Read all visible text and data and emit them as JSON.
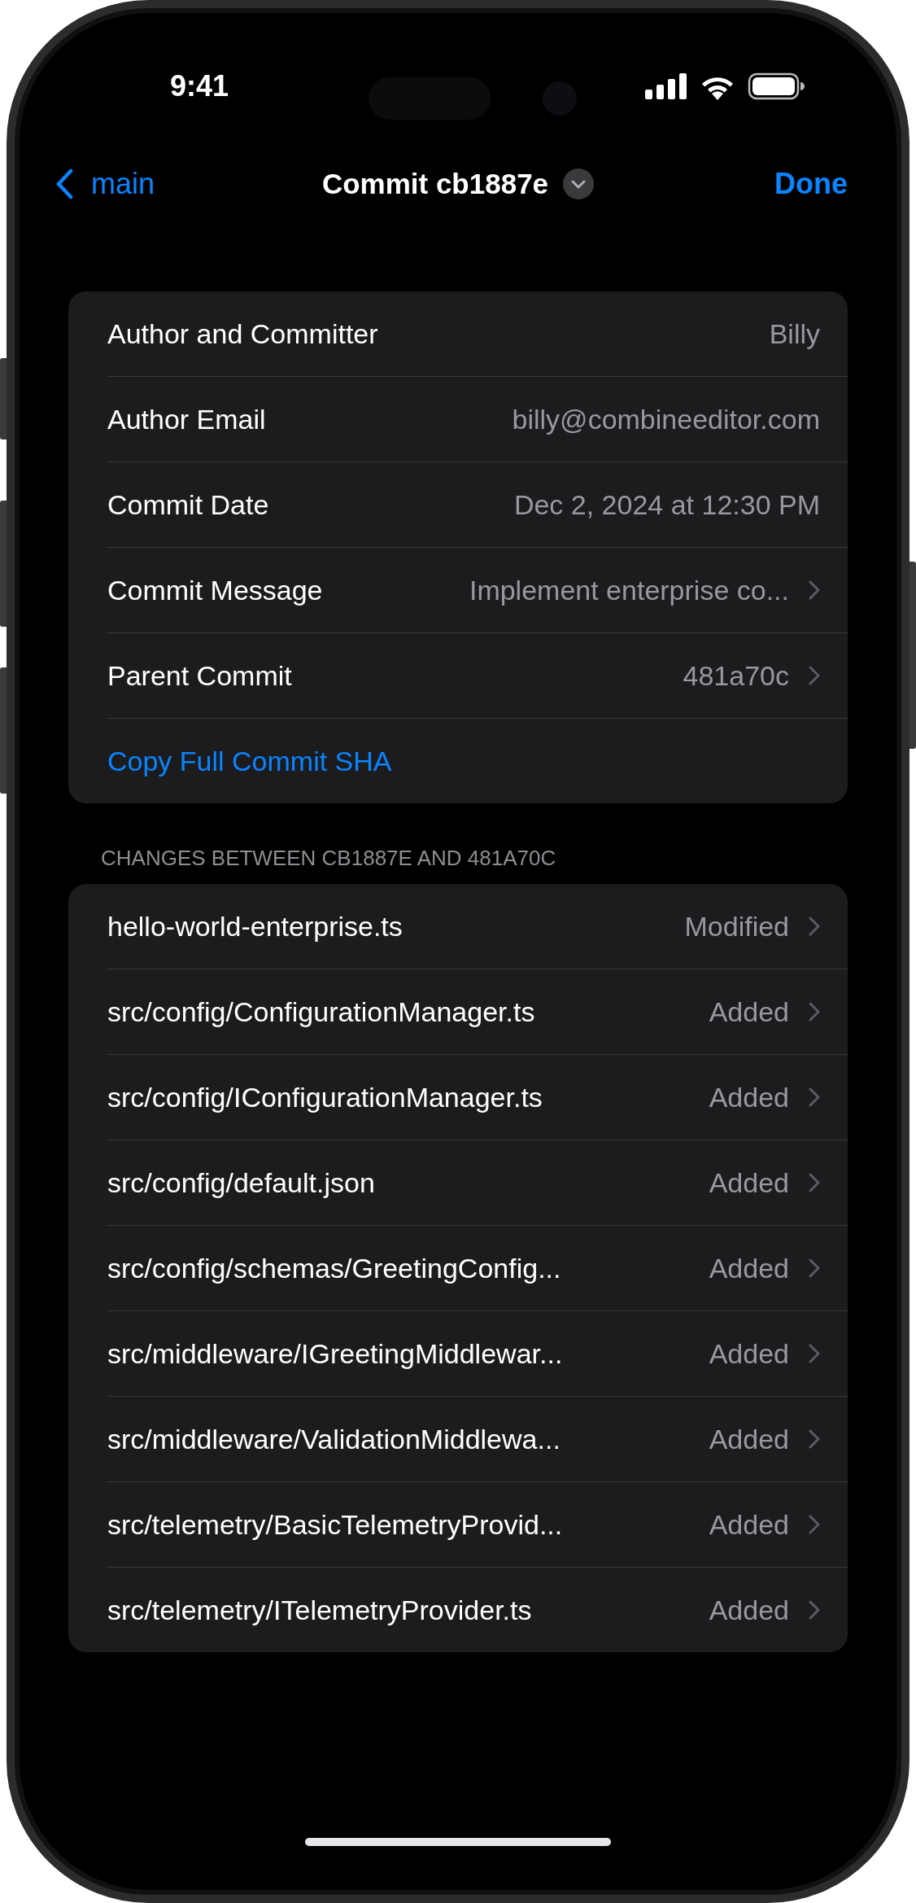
{
  "status_bar": {
    "time": "9:41"
  },
  "nav": {
    "back": "main",
    "title": "Commit cb1887e",
    "done": "Done"
  },
  "details": [
    {
      "kind": "value",
      "label": "Author and Committer",
      "value": "Billy",
      "disclosure": false
    },
    {
      "kind": "value",
      "label": "Author Email",
      "value": "billy@combineeditor.com",
      "disclosure": false
    },
    {
      "kind": "value",
      "label": "Commit Date",
      "value": "Dec 2, 2024 at 12:30 PM",
      "disclosure": false
    },
    {
      "kind": "value",
      "label": "Commit Message",
      "value": "Implement enterprise co...",
      "disclosure": true
    },
    {
      "kind": "value",
      "label": "Parent Commit",
      "value": "481a70c",
      "disclosure": true
    },
    {
      "kind": "action",
      "label": "Copy Full Commit SHA"
    }
  ],
  "changes": {
    "header": "CHANGES BETWEEN CB1887E AND 481A70C",
    "files": [
      {
        "name": "hello-world-enterprise.ts",
        "status": "Modified"
      },
      {
        "name": "src/config/ConfigurationManager.ts",
        "status": "Added"
      },
      {
        "name": "src/config/IConfigurationManager.ts",
        "status": "Added"
      },
      {
        "name": "src/config/default.json",
        "status": "Added"
      },
      {
        "name": "src/config/schemas/GreetingConfig...",
        "status": "Added"
      },
      {
        "name": "src/middleware/IGreetingMiddlewar...",
        "status": "Added"
      },
      {
        "name": "src/middleware/ValidationMiddlewa...",
        "status": "Added"
      },
      {
        "name": "src/telemetry/BasicTelemetryProvid...",
        "status": "Added"
      },
      {
        "name": "src/telemetry/ITelemetryProvider.ts",
        "status": "Added"
      }
    ]
  }
}
